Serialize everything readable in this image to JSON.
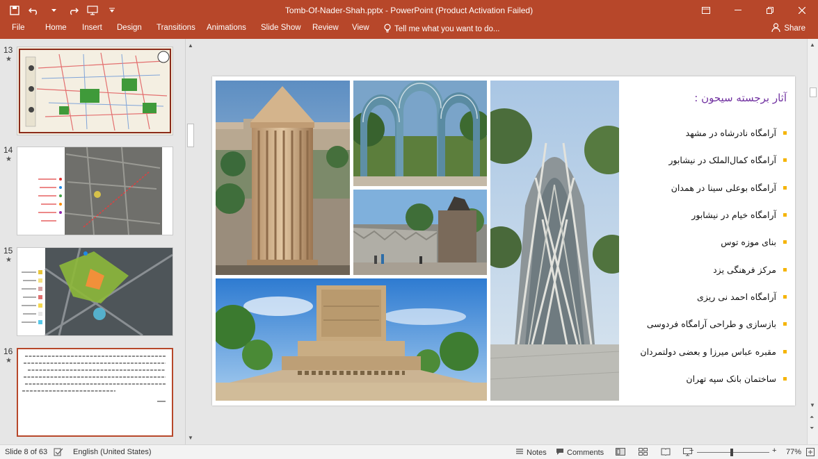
{
  "titlebar": {
    "title": "Tomb-Of-Nader-Shah.pptx - PowerPoint (Product Activation Failed)",
    "qat_icons": [
      "save-icon",
      "undo-icon",
      "redo-icon",
      "start-slideshow-icon",
      "customize-icon"
    ],
    "window_icons": [
      "ribbon-display-icon",
      "minimize-icon",
      "restore-icon",
      "close-icon"
    ]
  },
  "ribbon": {
    "tabs": [
      "File",
      "Home",
      "Insert",
      "Design",
      "Transitions",
      "Animations",
      "Slide Show",
      "Review",
      "View"
    ],
    "tellme": "Tell me what you want to do...",
    "share": "Share"
  },
  "thumbnails": [
    {
      "number": "13",
      "star": "★"
    },
    {
      "number": "14",
      "star": "★"
    },
    {
      "number": "15",
      "star": "★"
    },
    {
      "number": "16",
      "star": "★"
    }
  ],
  "slide": {
    "list_title": "آثار برجسته سیحون :",
    "items": [
      "آرامگاه نادرشاه در مشهد",
      "آرامگاه کمال‌الملک در نیشابور",
      "آرامگاه بوعلی سینا در همدان",
      "آرامگاه خیام در نیشابور",
      "بنای موزه توس",
      "مرکز فرهنگی یزد",
      "آرامگاه احمد نی ریزی",
      "بازسازی و طراحی آرامگاه فردوسی",
      "مقبره عباس میرزا و بعضی دولتمردان",
      "ساختمان بانک سپه تهران"
    ]
  },
  "statusbar": {
    "slide_info": "Slide 8 of 63",
    "language": "English (United States)",
    "notes": "Notes",
    "comments": "Comments",
    "zoom": "77%"
  },
  "colors": {
    "accent": "#b7472a",
    "title_purple": "#7030a0",
    "bullet": "#f5b400"
  }
}
